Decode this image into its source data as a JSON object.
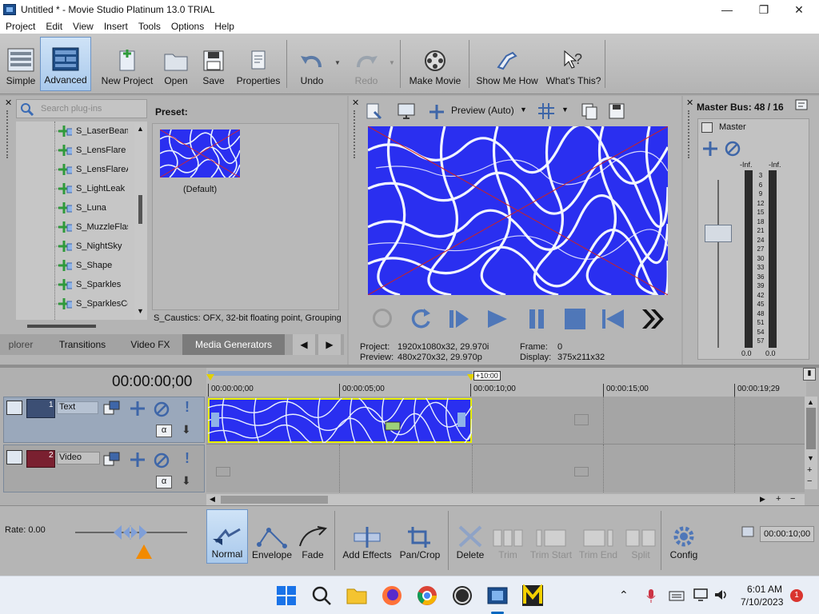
{
  "window": {
    "title": "Untitled * - Movie Studio Platinum 13.0 TRIAL"
  },
  "menu": [
    "Project",
    "Edit",
    "View",
    "Insert",
    "Tools",
    "Options",
    "Help"
  ],
  "toolbar": {
    "simple": "Simple",
    "advanced": "Advanced",
    "new_project": "New Project",
    "open": "Open",
    "save": "Save",
    "properties": "Properties",
    "undo": "Undo",
    "redo": "Redo",
    "make_movie": "Make Movie",
    "show_me_how": "Show Me How",
    "whats_this": "What's This?"
  },
  "plugins": {
    "search_placeholder": "Search plug-ins",
    "preset_label": "Preset:",
    "preset_name": "(Default)",
    "status": "S_Caustics: OFX, 32-bit floating point, Grouping",
    "items": [
      "S_LaserBeam",
      "S_LensFlare",
      "S_LensFlareA",
      "S_LightLeak",
      "S_Luna",
      "S_MuzzleFlas",
      "S_NightSky",
      "S_Shape",
      "S_Sparkles",
      "S_SparklesCo"
    ],
    "tabs": [
      "plorer",
      "Transitions",
      "Video FX",
      "Media Generators"
    ],
    "active_tab": "Media Generators"
  },
  "preview": {
    "mode": "Preview (Auto)",
    "project_label": "Project:",
    "project_value": "1920x1080x32, 29.970i",
    "preview_label": "Preview:",
    "preview_value": "480x270x32, 29.970p",
    "frame_label": "Frame:",
    "frame_value": "0",
    "display_label": "Display:",
    "display_value": "375x211x32"
  },
  "master": {
    "title": "Master Bus: 48 / 16",
    "name": "Master",
    "inf_left": "-Inf.",
    "inf_right": "-Inf.",
    "scale": [
      "3",
      "6",
      "9",
      "12",
      "15",
      "18",
      "21",
      "24",
      "27",
      "30",
      "33",
      "36",
      "39",
      "42",
      "45",
      "48",
      "51",
      "54",
      "57"
    ],
    "bottom_left": "0.0",
    "bottom_right": "0.0"
  },
  "timeline": {
    "timecode": "00:00:00;00",
    "marks": [
      "00:00:00;00",
      "00:00:05;00",
      "00:00:10;00",
      "00:00:15;00",
      "00:00:19;29"
    ],
    "loop_label": "+10:00",
    "tracks": [
      {
        "num": "1",
        "name": "Text"
      },
      {
        "num": "2",
        "name": "Video"
      }
    ]
  },
  "bottom": {
    "rate": "Rate: 0.00",
    "normal": "Normal",
    "envelope": "Envelope",
    "fade": "Fade",
    "add_effects": "Add Effects",
    "pan_crop": "Pan/Crop",
    "delete": "Delete",
    "trim": "Trim",
    "trim_start": "Trim Start",
    "trim_end": "Trim End",
    "split": "Split",
    "config": "Config",
    "end_time": "00:00:10;00"
  },
  "taskbar": {
    "time": "6:01 AM",
    "date": "7/10/2023",
    "notification_count": "1"
  },
  "colors": {
    "water": "#2a2ff0",
    "accent": "#6d95c7",
    "clip_border": "#e8f000",
    "text_track": "#3c4f74",
    "video_track": "#7a2030"
  }
}
